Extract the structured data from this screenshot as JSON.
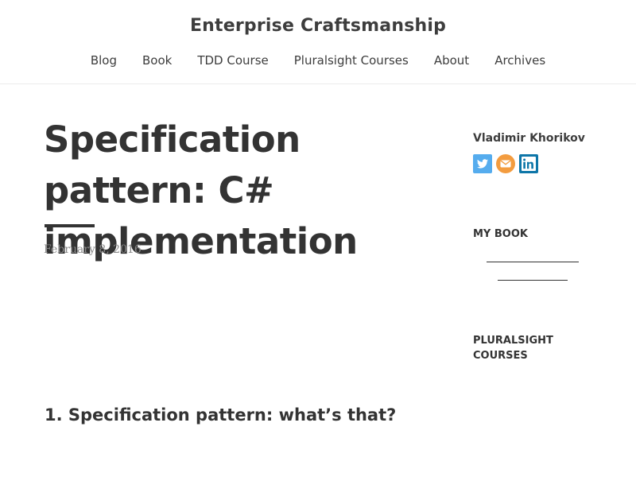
{
  "header": {
    "site_title": "Enterprise Craftsmanship",
    "nav": [
      {
        "label": "Blog"
      },
      {
        "label": "Book"
      },
      {
        "label": "TDD Course"
      },
      {
        "label": "Pluralsight Courses"
      },
      {
        "label": "About"
      },
      {
        "label": "Archives"
      }
    ]
  },
  "post": {
    "title": "Specification pattern: C# implementation",
    "date": "February 8, 2016",
    "section_heading": "1. Specification pattern: what’s that?"
  },
  "sidebar": {
    "author_name": "Vladimir Khorikov",
    "social": [
      {
        "icon": "twitter-icon",
        "color": "#55acee"
      },
      {
        "icon": "email-icon",
        "color": "#f39c3f"
      },
      {
        "icon": "linkedin-icon",
        "color": "#0e76a8"
      }
    ],
    "book_widget_title": "MY BOOK",
    "pluralsight_widget_title": "PLURALSIGHT COURSES"
  }
}
